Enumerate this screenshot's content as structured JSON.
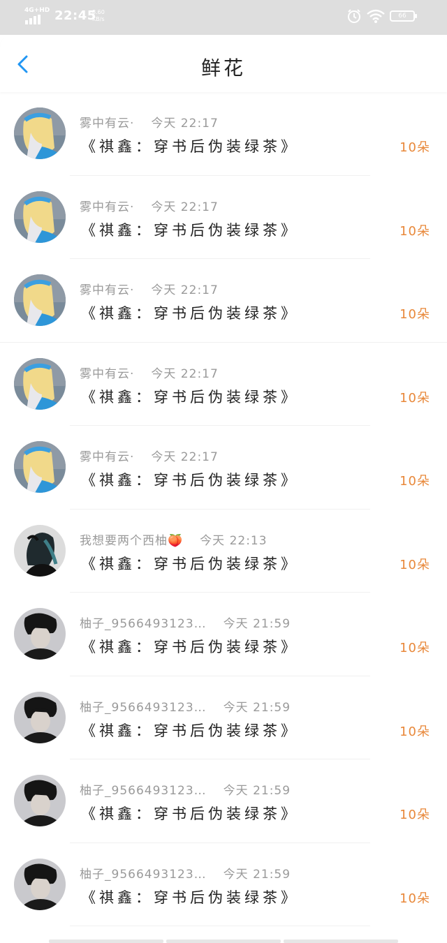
{
  "status_bar": {
    "network": "4G+HD",
    "time": "22:45",
    "speed_value": "8.60",
    "speed_unit": "KB/s",
    "battery": "66"
  },
  "header": {
    "title": "鲜花"
  },
  "rows": [
    {
      "user": "雾中有云·",
      "time": "今天 22:17",
      "book": "《祺鑫：穿书后伪装绿茶》",
      "amount": "10朵",
      "avatar": "blonde"
    },
    {
      "user": "雾中有云·",
      "time": "今天 22:17",
      "book": "《祺鑫：穿书后伪装绿茶》",
      "amount": "10朵",
      "avatar": "blonde"
    },
    {
      "user": "雾中有云·",
      "time": "今天 22:17",
      "book": "《祺鑫：穿书后伪装绿茶》",
      "amount": "10朵",
      "avatar": "blonde"
    },
    {
      "user": "雾中有云·",
      "time": "今天 22:17",
      "book": "《祺鑫：穿书后伪装绿茶》",
      "amount": "10朵",
      "avatar": "blonde"
    },
    {
      "user": "雾中有云·",
      "time": "今天 22:17",
      "book": "《祺鑫：穿书后伪装绿茶》",
      "amount": "10朵",
      "avatar": "blonde"
    },
    {
      "user": "我想要两个西柚🍑",
      "time": "今天 22:13",
      "book": "《祺鑫：穿书后伪装绿茶》",
      "amount": "10朵",
      "avatar": "dark-hair"
    },
    {
      "user": "柚子_9566493123…",
      "time": "今天 21:59",
      "book": "《祺鑫：穿书后伪装绿茶》",
      "amount": "10朵",
      "avatar": "boy"
    },
    {
      "user": "柚子_9566493123…",
      "time": "今天 21:59",
      "book": "《祺鑫：穿书后伪装绿茶》",
      "amount": "10朵",
      "avatar": "boy"
    },
    {
      "user": "柚子_9566493123…",
      "time": "今天 21:59",
      "book": "《祺鑫：穿书后伪装绿茶》",
      "amount": "10朵",
      "avatar": "boy"
    },
    {
      "user": "柚子_9566493123…",
      "time": "今天 21:59",
      "book": "《祺鑫：穿书后伪装绿茶》",
      "amount": "10朵",
      "avatar": "boy"
    }
  ],
  "colors": {
    "accent": "#2196f3",
    "amount": "#e8883a",
    "status_bar": "#dedede"
  },
  "icons": {
    "back": "chevron-left-icon",
    "alarm": "alarm-icon",
    "wifi": "wifi-icon",
    "battery": "battery-icon"
  }
}
